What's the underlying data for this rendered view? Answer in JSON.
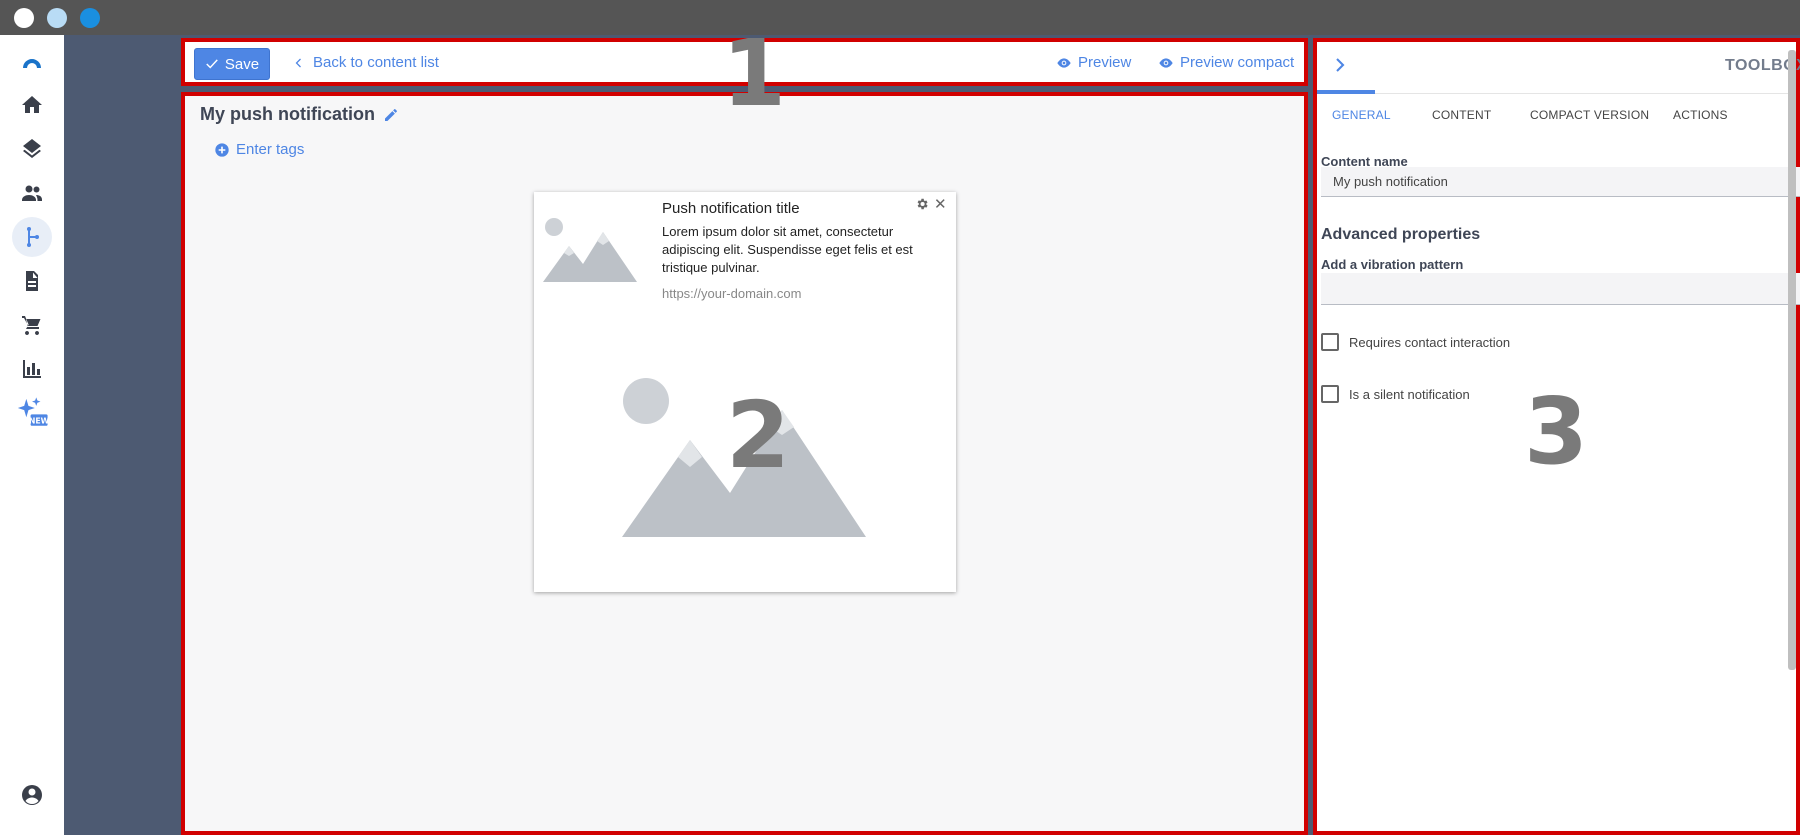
{
  "window": {
    "controls": [
      "close",
      "minimize",
      "maximize"
    ],
    "control_colors": [
      "#ffffff",
      "#b9dcf5",
      "#1a8fe0"
    ]
  },
  "nav": {
    "items": [
      "logo-icon",
      "home-icon",
      "layers-icon",
      "people-icon",
      "journey-icon",
      "document-icon",
      "cart-icon",
      "analytics-icon",
      "sparkle-new-icon",
      "account-icon"
    ],
    "new_badge": "NEW",
    "active": "journey-icon"
  },
  "toolbar": {
    "save_label": "Save",
    "back_label": "Back to content list",
    "preview_label": "Preview",
    "preview_compact_label": "Preview compact"
  },
  "annotations": {
    "region1": "1",
    "region2": "2",
    "region3": "3",
    "border_color": "#d10000"
  },
  "editor": {
    "content_title": "My push notification",
    "tags_label": "Enter tags"
  },
  "push_preview": {
    "title": "Push notification title",
    "body": "Lorem ipsum dolor sit amet, consectetur adipiscing elit. Suspendisse eget felis et est tristique pulvinar.",
    "url": "https://your-domain.com"
  },
  "toolbox": {
    "title": "TOOLBOX",
    "tabs": [
      "GENERAL",
      "CONTENT",
      "COMPACT VERSION",
      "ACTIONS"
    ],
    "active_tab": "GENERAL",
    "content_name_label": "Content name",
    "content_name_value": "My push notification",
    "advanced_heading": "Advanced properties",
    "vibration_label": "Add a vibration pattern",
    "vibration_value": "",
    "checkbox_contact": "Requires contact interaction",
    "checkbox_silent": "Is a silent notification"
  },
  "colors": {
    "accent": "#4e86e4",
    "sidebar_dark": "#4d5a72"
  }
}
